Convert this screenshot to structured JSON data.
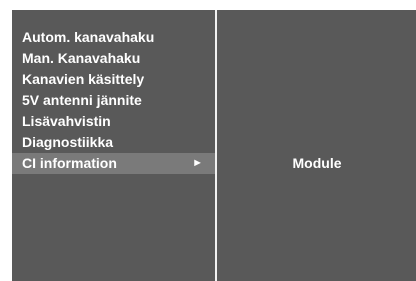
{
  "menu": {
    "items": [
      {
        "label": "Autom. kanavahaku"
      },
      {
        "label": "Man. Kanavahaku"
      },
      {
        "label": "Kanavien käsittely"
      },
      {
        "label": "5V antenni jännite"
      },
      {
        "label": "Lisävahvistin"
      },
      {
        "label": "Diagnostiikka"
      },
      {
        "label": "CI information",
        "selected": true,
        "has_submenu": true,
        "arrow": "►"
      }
    ]
  },
  "submenu": {
    "items": [
      {
        "label": "Module"
      }
    ]
  },
  "colors": {
    "panel_bg": "#595959",
    "highlight_bg": "#7a7a7a",
    "divider": "#f2f2f2",
    "text": "#ffffff"
  },
  "icons": {
    "submenu_arrow": "right-triangle-icon"
  }
}
